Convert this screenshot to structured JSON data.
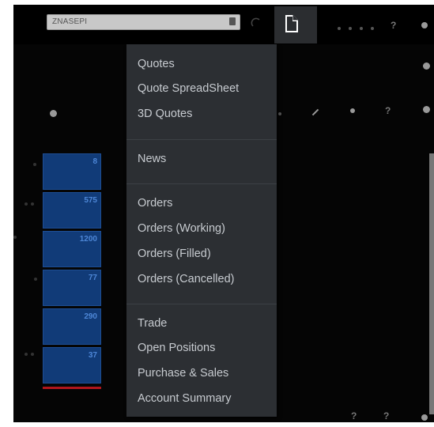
{
  "toolbar": {
    "symbol_value": "ZNASEPI",
    "icons": [
      "refresh-icon",
      "new-document-icon",
      "help-icon",
      "close-icon"
    ],
    "bottom_help_1": "?",
    "bottom_help_2": "?",
    "right_help": "?"
  },
  "menu": {
    "groups": [
      {
        "items": [
          "Quotes",
          "Quote SpreadSheet",
          "3D Quotes"
        ]
      },
      {
        "items": [
          "News"
        ]
      },
      {
        "items": [
          "Orders",
          "Orders (Working)",
          "Orders (Filled)",
          "Orders (Cancelled)"
        ]
      },
      {
        "items": [
          "Trade",
          "Open Positions",
          "Purchase & Sales",
          "Account Summary"
        ]
      }
    ]
  },
  "ladder": {
    "values": [
      "8",
      "575",
      "1200",
      "77",
      "290",
      "37"
    ],
    "bar_color": "#113b78",
    "alert_color": "#b0161c"
  }
}
